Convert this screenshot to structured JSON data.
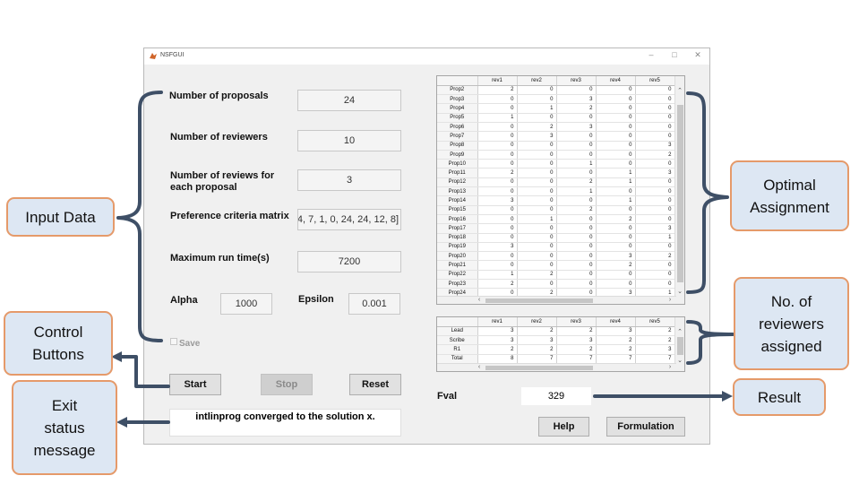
{
  "window": {
    "title": "NSFGUI",
    "controls": [
      "–",
      "□",
      "✕"
    ]
  },
  "inputs": {
    "num_proposals": {
      "label": "Number of proposals",
      "value": "24"
    },
    "num_reviewers": {
      "label": "Number of reviewers",
      "value": "10"
    },
    "reviews_per_proposal": {
      "label_line1": "Number of reviews for",
      "label_line2": "each proposal",
      "value": "3"
    },
    "preference_matrix": {
      "label": "Preference criteria matrix",
      "value": "4, 7, 1, 0, 24, 24, 12, 8]"
    },
    "max_run_time": {
      "label": "Maximum run time(s)",
      "value": "7200"
    },
    "alpha": {
      "label": "Alpha",
      "value": "1000"
    },
    "epsilon": {
      "label": "Epsilon",
      "value": "0.001"
    },
    "save": {
      "label": "Save"
    }
  },
  "buttons": {
    "start": "Start",
    "stop": "Stop",
    "reset": "Reset",
    "help": "Help",
    "formulation": "Formulation"
  },
  "status": {
    "message": "intlinprog converged to the solution x."
  },
  "result": {
    "label": "Fval",
    "value": "329"
  },
  "assignment_table": {
    "columns": [
      "rev1",
      "rev2",
      "rev3",
      "rev4",
      "rev5"
    ],
    "rows": [
      {
        "name": "Prop2",
        "values": [
          "2",
          "0",
          "0",
          "0",
          "0"
        ]
      },
      {
        "name": "Prop3",
        "values": [
          "0",
          "0",
          "3",
          "0",
          "0"
        ]
      },
      {
        "name": "Prop4",
        "values": [
          "0",
          "1",
          "2",
          "0",
          "0"
        ]
      },
      {
        "name": "Prop5",
        "values": [
          "1",
          "0",
          "0",
          "0",
          "0"
        ]
      },
      {
        "name": "Prop6",
        "values": [
          "0",
          "2",
          "3",
          "0",
          "0"
        ]
      },
      {
        "name": "Prop7",
        "values": [
          "0",
          "3",
          "0",
          "0",
          "0"
        ]
      },
      {
        "name": "Prop8",
        "values": [
          "0",
          "0",
          "0",
          "0",
          "3"
        ]
      },
      {
        "name": "Prop9",
        "values": [
          "0",
          "0",
          "0",
          "0",
          "2"
        ]
      },
      {
        "name": "Prop10",
        "values": [
          "0",
          "0",
          "1",
          "0",
          "0"
        ]
      },
      {
        "name": "Prop11",
        "values": [
          "2",
          "0",
          "0",
          "1",
          "3"
        ]
      },
      {
        "name": "Prop12",
        "values": [
          "0",
          "0",
          "2",
          "1",
          "0"
        ]
      },
      {
        "name": "Prop13",
        "values": [
          "0",
          "0",
          "1",
          "0",
          "0"
        ]
      },
      {
        "name": "Prop14",
        "values": [
          "3",
          "0",
          "0",
          "1",
          "0"
        ]
      },
      {
        "name": "Prop15",
        "values": [
          "0",
          "0",
          "2",
          "0",
          "0"
        ]
      },
      {
        "name": "Prop16",
        "values": [
          "0",
          "1",
          "0",
          "2",
          "0"
        ]
      },
      {
        "name": "Prop17",
        "values": [
          "0",
          "0",
          "0",
          "0",
          "3"
        ]
      },
      {
        "name": "Prop18",
        "values": [
          "0",
          "0",
          "0",
          "0",
          "1"
        ]
      },
      {
        "name": "Prop19",
        "values": [
          "3",
          "0",
          "0",
          "0",
          "0"
        ]
      },
      {
        "name": "Prop20",
        "values": [
          "0",
          "0",
          "0",
          "3",
          "2"
        ]
      },
      {
        "name": "Prop21",
        "values": [
          "0",
          "0",
          "0",
          "2",
          "0"
        ]
      },
      {
        "name": "Prop22",
        "values": [
          "1",
          "2",
          "0",
          "0",
          "0"
        ]
      },
      {
        "name": "Prop23",
        "values": [
          "2",
          "0",
          "0",
          "0",
          "0"
        ]
      },
      {
        "name": "Prop24",
        "values": [
          "0",
          "2",
          "0",
          "3",
          "1"
        ]
      }
    ]
  },
  "count_table": {
    "columns": [
      "rev1",
      "rev2",
      "rev3",
      "rev4",
      "rev5"
    ],
    "rows": [
      {
        "name": "Lead",
        "values": [
          "3",
          "2",
          "2",
          "3",
          "2"
        ]
      },
      {
        "name": "Scribe",
        "values": [
          "3",
          "3",
          "3",
          "2",
          "2"
        ]
      },
      {
        "name": "R1",
        "values": [
          "2",
          "2",
          "2",
          "2",
          "3"
        ]
      },
      {
        "name": "Total",
        "values": [
          "8",
          "7",
          "7",
          "7",
          "7"
        ]
      }
    ]
  },
  "annotations": {
    "input_data": "Input Data",
    "control_buttons": [
      "Control",
      "Buttons"
    ],
    "exit_status": [
      "Exit",
      "status",
      "message"
    ],
    "optimal_assignment": [
      "Optimal",
      "Assignment"
    ],
    "reviewers_assigned": [
      "No. of",
      "reviewers",
      "assigned"
    ],
    "result": "Result"
  },
  "colors": {
    "callout_fill": "#dde7f3",
    "callout_border": "#e59a6a",
    "bracket": "#3e4f66"
  }
}
